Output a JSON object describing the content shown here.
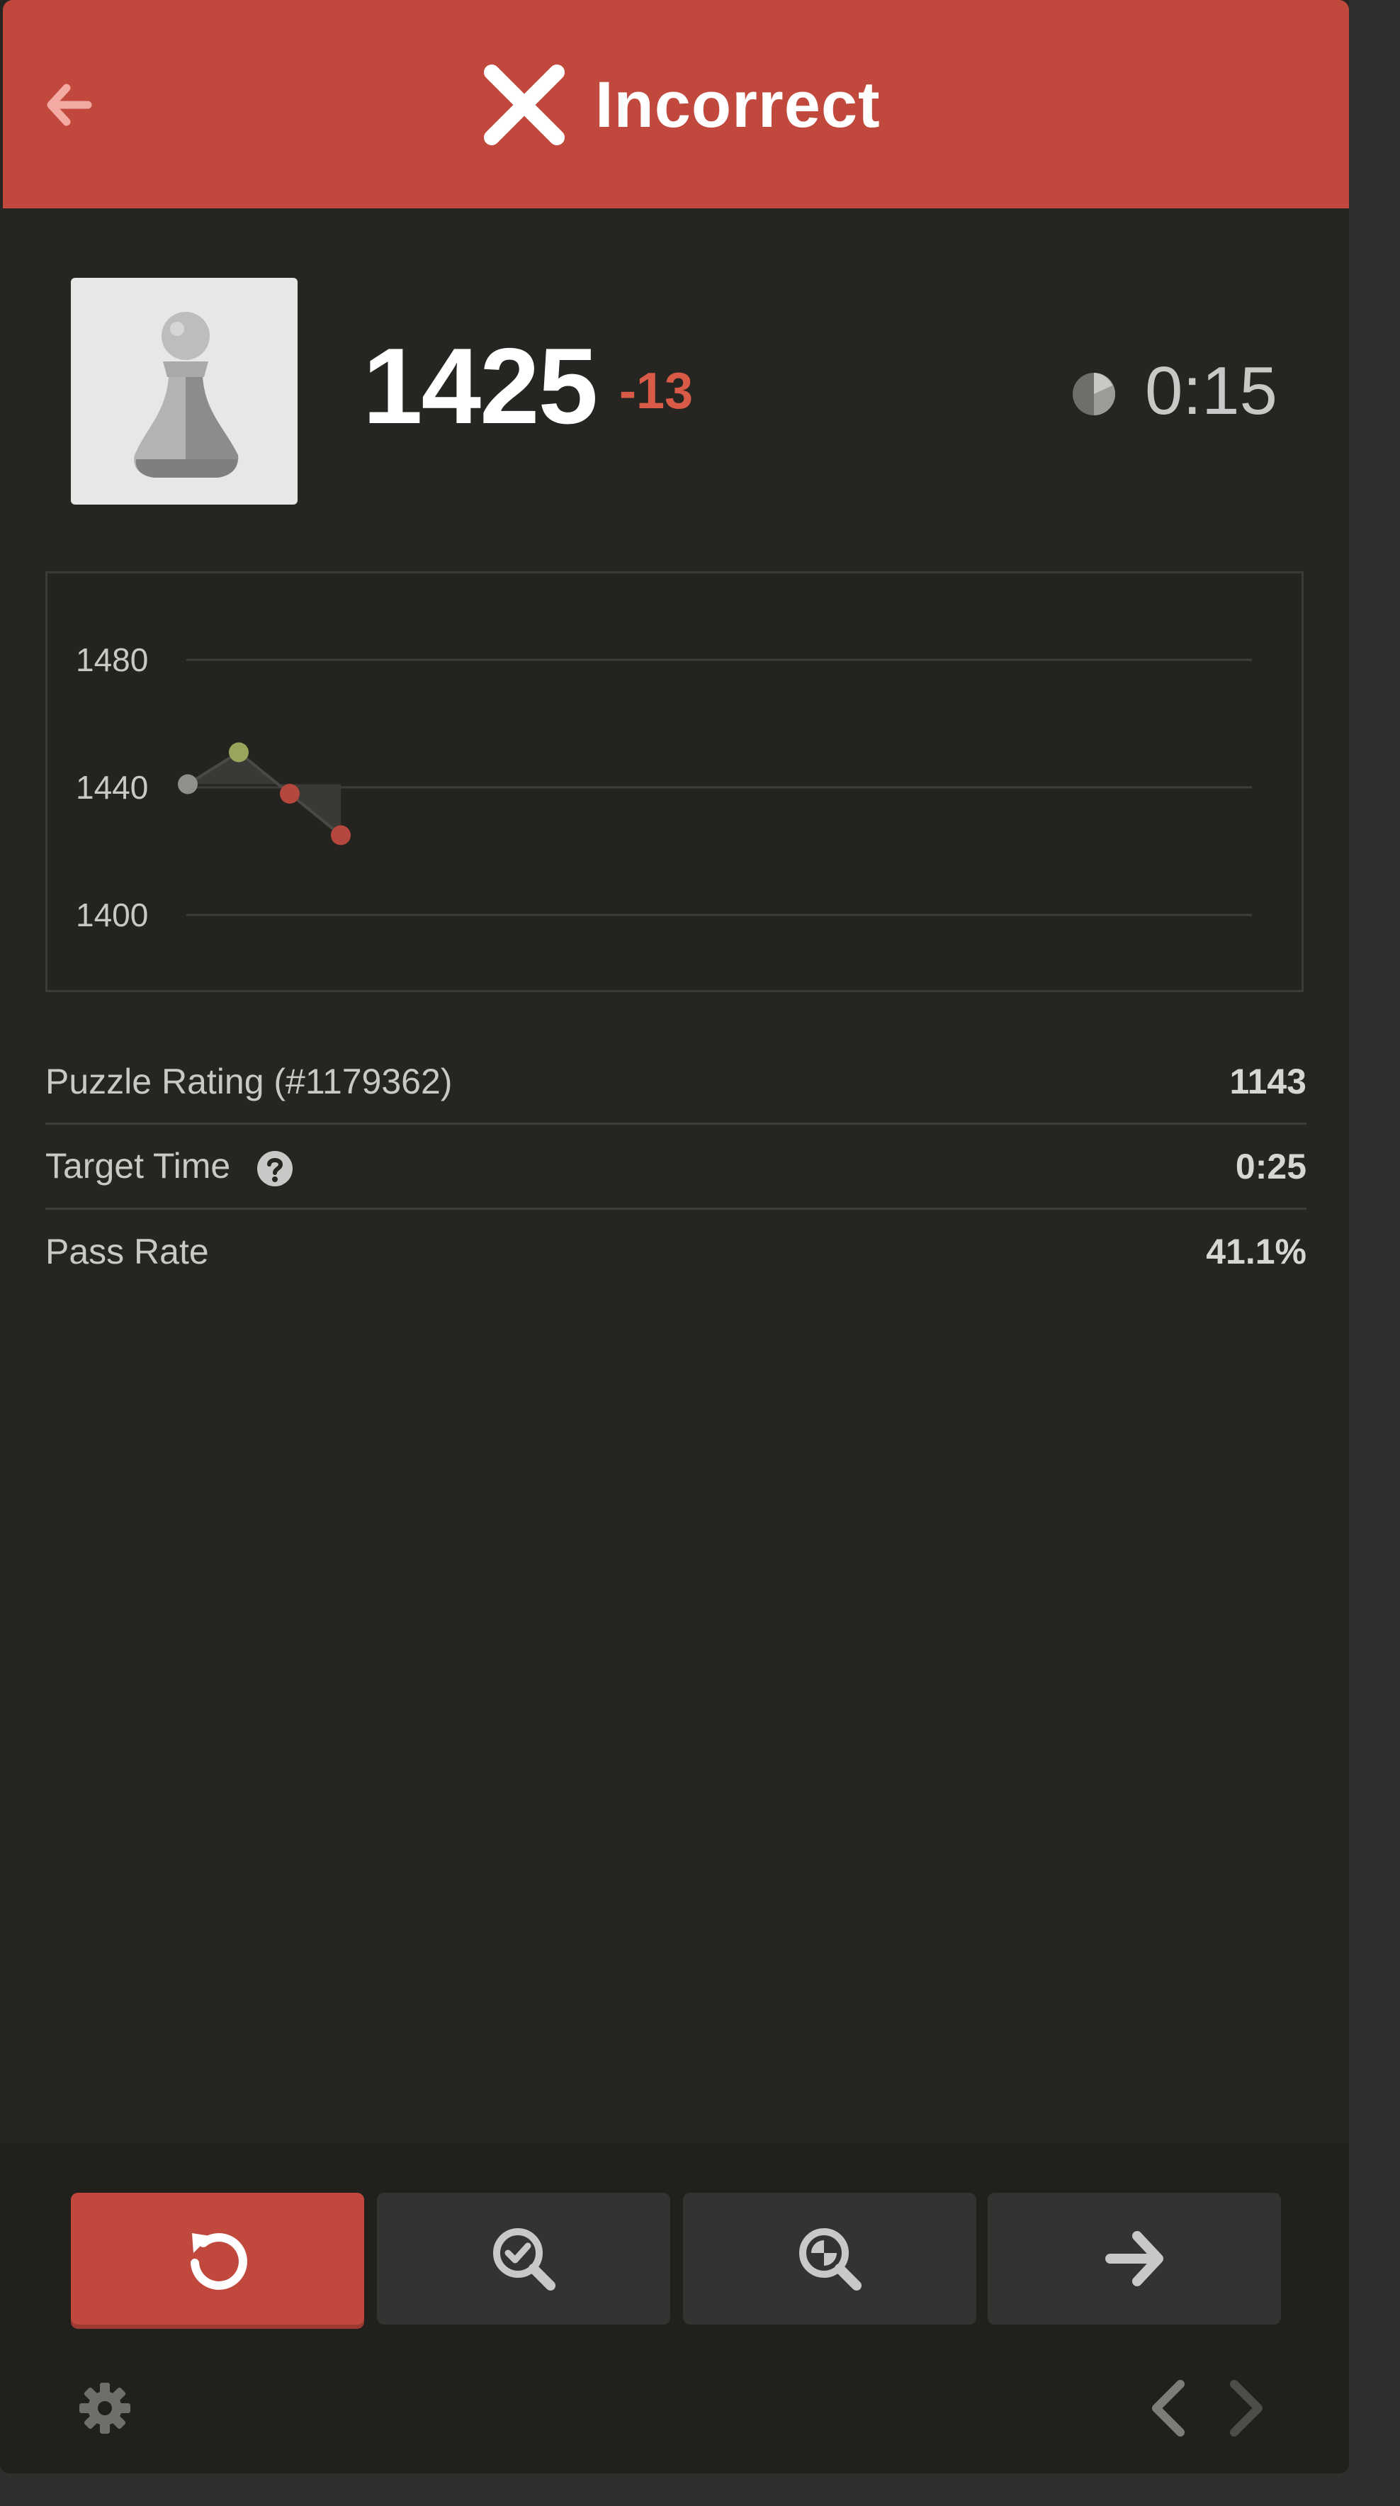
{
  "header": {
    "status_label": "Incorrect",
    "back_icon": "arrow-left-icon",
    "status_icon": "x-mark-icon",
    "color": "#c1483c"
  },
  "player": {
    "avatar_icon": "pawn-icon",
    "rating": "1425",
    "rating_delta": "-13",
    "timer_icon": "half-circle-clock-icon",
    "elapsed": "0:15"
  },
  "chart_data": {
    "type": "line",
    "yticks": [
      "1480",
      "1440",
      "1400"
    ],
    "ylim": [
      1400,
      1480
    ],
    "grid": true,
    "x": [
      1,
      2,
      3,
      4
    ],
    "values": [
      1441,
      1451,
      1438,
      1425
    ],
    "point_colors": [
      "#8f8f8c",
      "#98a55a",
      "#b5473f",
      "#b5473f"
    ]
  },
  "stats": [
    {
      "label": "Puzzle Rating (#1179362)",
      "value": "1143"
    },
    {
      "label": "Target Time",
      "value": "0:25",
      "help_icon": "question-circle-icon"
    },
    {
      "label": "Pass Rate",
      "value": "41.1%"
    }
  ],
  "actions": {
    "retry_icon": "retry-icon",
    "solution_icon": "magnify-check-icon",
    "analysis_icon": "magnify-analysis-icon",
    "next_icon": "arrow-right-icon"
  },
  "footer": {
    "settings_icon": "gear-icon",
    "prev_icon": "chevron-left-icon",
    "next_icon": "chevron-right-icon"
  }
}
